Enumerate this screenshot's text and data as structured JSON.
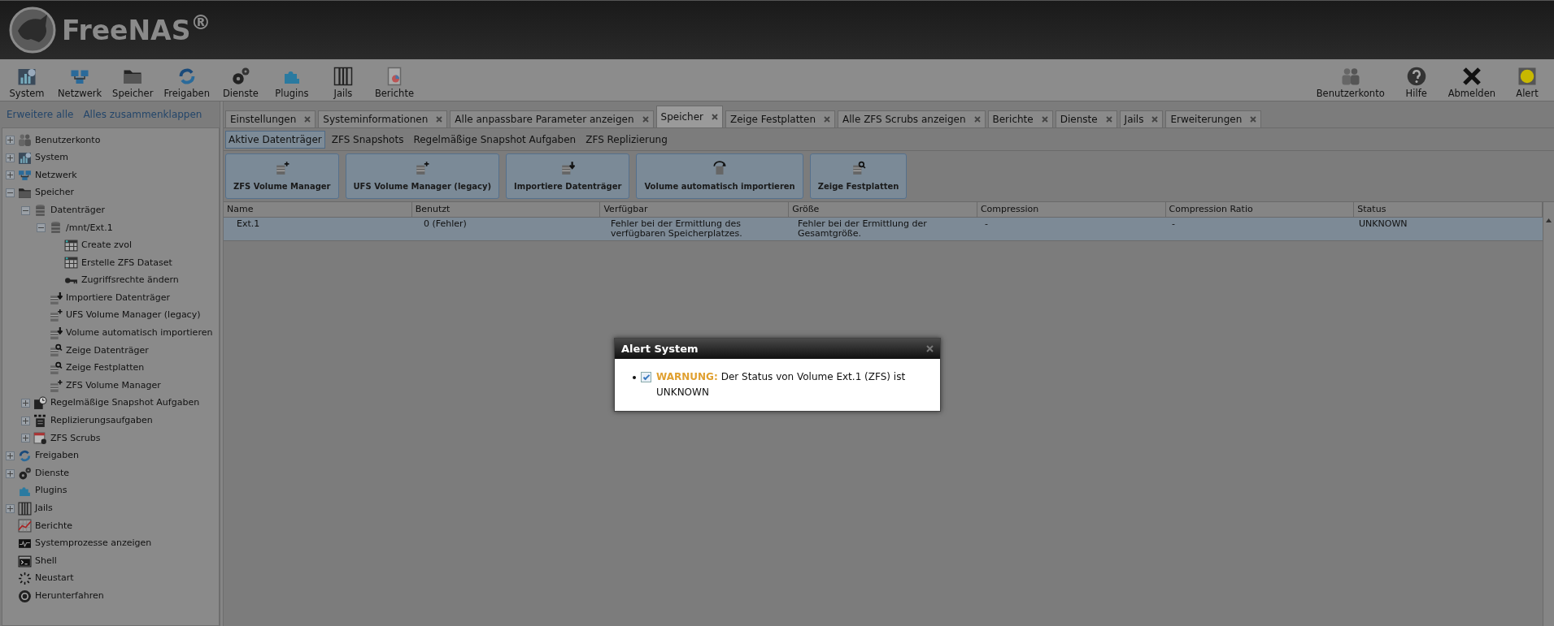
{
  "header": {
    "logo_text": "FreeNAS$^{®}$"
  },
  "toolbar": {
    "left": [
      {
        "label": "System",
        "kind": "chart"
      },
      {
        "label": "Netzwerk",
        "kind": "network"
      },
      {
        "label": "Speicher",
        "kind": "folder"
      },
      {
        "label": "Freigaben",
        "kind": "share"
      },
      {
        "label": "Dienste",
        "kind": "gears"
      },
      {
        "label": "Plugins",
        "kind": "puzzle"
      },
      {
        "label": "Jails",
        "kind": "jail"
      },
      {
        "label": "Berichte",
        "kind": "report"
      }
    ],
    "right": [
      {
        "label": "Benutzerkonto",
        "kind": "users"
      },
      {
        "label": "Hilfe",
        "kind": "help"
      },
      {
        "label": "Abmelden",
        "kind": "logout"
      },
      {
        "label": "Alert",
        "kind": "alert"
      }
    ]
  },
  "sidebar": {
    "links": [
      "Erweitere alle",
      "Alles zusammenklappen"
    ],
    "tree": [
      {
        "label": "Benutzerkonto",
        "kind": "users",
        "expanded": false
      },
      {
        "label": "System",
        "kind": "chart",
        "expanded": false
      },
      {
        "label": "Netzwerk",
        "kind": "network",
        "expanded": false
      },
      {
        "label": "Speicher",
        "kind": "folder",
        "expanded": true,
        "children": [
          {
            "label": "Datenträger",
            "kind": "disk",
            "expanded": true,
            "children": [
              {
                "label": "/mnt/Ext.1",
                "kind": "disk",
                "expanded": true,
                "children": [
                  {
                    "label": "Create zvol",
                    "kind": "table"
                  },
                  {
                    "label": "Erstelle ZFS Dataset",
                    "kind": "table"
                  },
                  {
                    "label": "Zugriffsrechte ändern",
                    "kind": "key"
                  }
                ]
              },
              {
                "label": "Importiere Datenträger",
                "kind": "import"
              },
              {
                "label": "UFS Volume Manager (legacy)",
                "kind": "add"
              },
              {
                "label": "Volume automatisch importieren",
                "kind": "import"
              },
              {
                "label": "Zeige Datenträger",
                "kind": "search"
              },
              {
                "label": "Zeige Festplatten",
                "kind": "search"
              },
              {
                "label": "ZFS Volume Manager",
                "kind": "add"
              }
            ]
          },
          {
            "label": "Regelmäßige Snapshot Aufgaben",
            "kind": "clock",
            "expanded": false
          },
          {
            "label": "Replizierungsaufgaben",
            "kind": "list",
            "expanded": false
          },
          {
            "label": "ZFS Scrubs",
            "kind": "calendar",
            "expanded": false
          }
        ]
      },
      {
        "label": "Freigaben",
        "kind": "share",
        "expanded": false
      },
      {
        "label": "Dienste",
        "kind": "gears",
        "expanded": false
      },
      {
        "label": "Plugins",
        "kind": "puzzle"
      },
      {
        "label": "Jails",
        "kind": "jail",
        "expanded": false
      },
      {
        "label": "Berichte",
        "kind": "graph"
      },
      {
        "label": "Systemprozesse anzeigen",
        "kind": "monitor"
      },
      {
        "label": "Shell",
        "kind": "terminal"
      },
      {
        "label": "Neustart",
        "kind": "spinner"
      },
      {
        "label": "Herunterfahren",
        "kind": "power"
      }
    ]
  },
  "tabs": [
    {
      "label": "Einstellungen",
      "selected": false
    },
    {
      "label": "Systeminformationen",
      "selected": false
    },
    {
      "label": "Alle anpassbare Parameter anzeigen",
      "selected": false
    },
    {
      "label": "Speicher",
      "selected": true
    },
    {
      "label": "Zeige Festplatten",
      "selected": false
    },
    {
      "label": "Alle ZFS Scrubs anzeigen",
      "selected": false
    },
    {
      "label": "Berichte",
      "selected": false
    },
    {
      "label": "Dienste",
      "selected": false
    },
    {
      "label": "Jails",
      "selected": false
    },
    {
      "label": "Erweiterungen",
      "selected": false
    }
  ],
  "subtabs": [
    {
      "label": "Aktive Datenträger",
      "selected": true
    },
    {
      "label": "ZFS Snapshots",
      "selected": false
    },
    {
      "label": "Regelmäßige Snapshot Aufgaben",
      "selected": false
    },
    {
      "label": "ZFS Replizierung",
      "selected": false
    }
  ],
  "actions": [
    {
      "label": "ZFS Volume Manager",
      "kind": "add"
    },
    {
      "label": "UFS Volume Manager (legacy)",
      "kind": "add"
    },
    {
      "label": "Importiere Datenträger",
      "kind": "import"
    },
    {
      "label": "Volume automatisch importieren",
      "kind": "refresh"
    },
    {
      "label": "Zeige Festplatten",
      "kind": "search"
    }
  ],
  "table": {
    "columns": [
      "Name",
      "Benutzt",
      "Verfügbar",
      "Größe",
      "Compression",
      "Compression Ratio",
      "Status"
    ],
    "rows": [
      {
        "selected": true,
        "cells": [
          "Ext.1",
          "0 (Fehler)",
          "Fehler bei der Ermittlung des verfügbaren Speicherplatzes.",
          "Fehler bei der Ermittlung der Gesamtgröße.",
          "-",
          "-",
          "UNKNOWN"
        ]
      }
    ]
  },
  "dialog": {
    "title": "Alert System",
    "alerts": [
      {
        "checked": true,
        "severity": "WARNUNG:",
        "color": "#e0a030",
        "message": "Der Status von Volume Ext.1 (ZFS) ist UNKNOWN"
      }
    ]
  }
}
